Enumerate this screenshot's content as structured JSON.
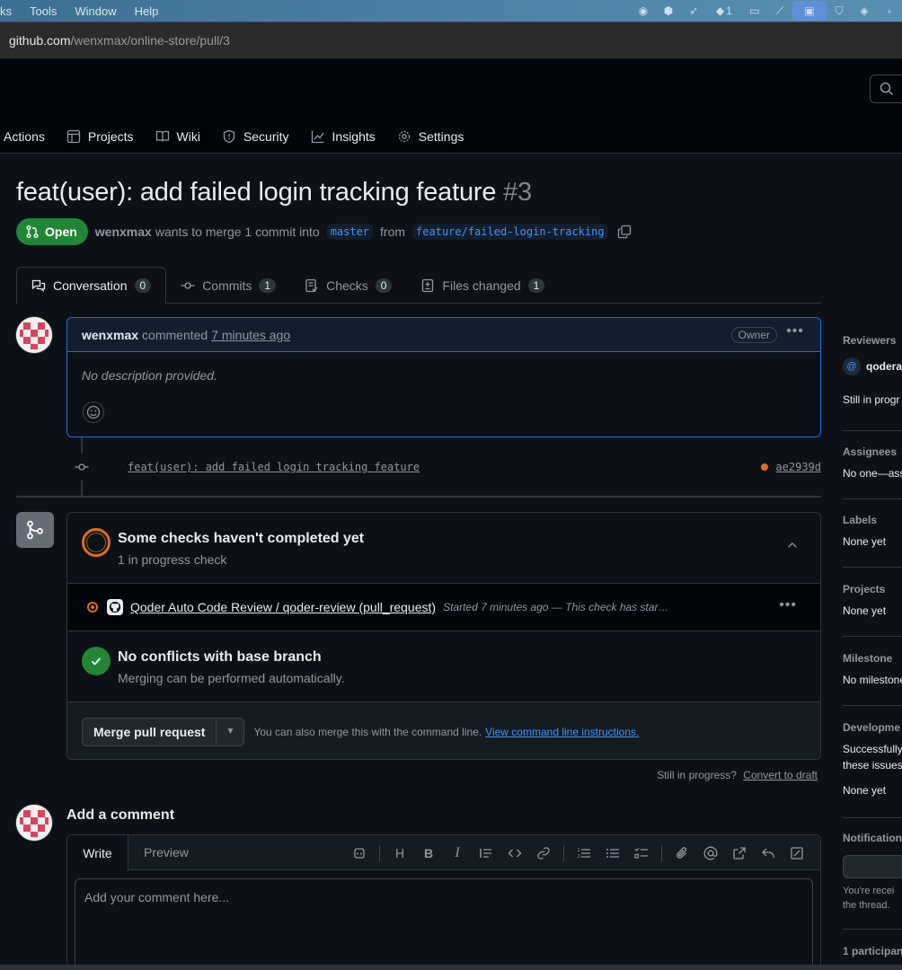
{
  "menubar": {
    "items": [
      "ks",
      "Tools",
      "Window",
      "Help"
    ],
    "tray_badge": "1"
  },
  "browser": {
    "url_host": "github.com",
    "url_path": "/wenxmax/online-store/pull/3"
  },
  "repo_nav": {
    "items": [
      {
        "label": "Actions",
        "icon": "play-icon"
      },
      {
        "label": "Projects",
        "icon": "table-icon"
      },
      {
        "label": "Wiki",
        "icon": "book-icon"
      },
      {
        "label": "Security",
        "icon": "shield-icon"
      },
      {
        "label": "Insights",
        "icon": "graph-icon"
      },
      {
        "label": "Settings",
        "icon": "gear-icon"
      }
    ]
  },
  "pr": {
    "title": "feat(user): add failed login tracking feature",
    "number": "#3",
    "state": "Open",
    "author": "wenxmax",
    "merge_text": "wants to merge 1 commit into",
    "base_branch": "master",
    "from_text": "from",
    "head_branch": "feature/failed-login-tracking"
  },
  "tabs": [
    {
      "label": "Conversation",
      "count": "0"
    },
    {
      "label": "Commits",
      "count": "1"
    },
    {
      "label": "Checks",
      "count": "0"
    },
    {
      "label": "Files changed",
      "count": "1"
    }
  ],
  "comment": {
    "author": "wenxmax",
    "action": "commented",
    "time": "7 minutes ago",
    "badge": "Owner",
    "body": "No description provided."
  },
  "commit": {
    "message": "feat(user): add failed login tracking feature",
    "sha": "ae2939d",
    "status_color": "#db6d28"
  },
  "mergebox": {
    "checks_title": "Some checks haven't completed yet",
    "checks_sub": "1 in progress check",
    "check_name": "Qoder Auto Code Review / qoder-review (pull_request)",
    "check_status": "Started 7 minutes ago — This check has star…",
    "conflicts_title": "No conflicts with base branch",
    "conflicts_sub": "Merging can be performed automatically.",
    "merge_button": "Merge pull request",
    "cli_text": "You can also merge this with the command line.",
    "cli_link": "View command line instructions."
  },
  "draft": {
    "text": "Still in progress?",
    "link": "Convert to draft"
  },
  "add_comment": {
    "title": "Add a comment",
    "tab_write": "Write",
    "tab_preview": "Preview",
    "placeholder": "Add your comment here..."
  },
  "sidebar": {
    "reviewers_h": "Reviewers",
    "reviewer": "qodera",
    "reviewer_status": "Still in progr",
    "assignees_h": "Assignees",
    "assignees_v": "No one—ass",
    "labels_h": "Labels",
    "labels_v": "None yet",
    "projects_h": "Projects",
    "projects_v": "None yet",
    "milestone_h": "Milestone",
    "milestone_v": "No milestone",
    "development_h": "Developme",
    "development_v1": "Successfully",
    "development_v2": "these issues",
    "development_v3": "None yet",
    "notifications_h": "Notification",
    "notifications_v1": "You're recei",
    "notifications_v2": "the thread.",
    "participants_h": "1 participan"
  },
  "colors": {
    "bg": "#0d1117",
    "open_green": "#238636",
    "accent_blue": "#1f6feb",
    "link_blue": "#4493f8",
    "pending_orange": "#db6d28"
  }
}
